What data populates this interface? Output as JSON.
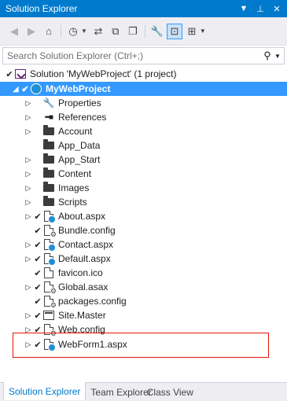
{
  "window": {
    "title": "Solution Explorer",
    "controls": {
      "dropdown": "▼",
      "pin": "⊥",
      "close": "✕"
    }
  },
  "toolbar": {
    "icons": [
      "back-icon",
      "forward-icon",
      "home-icon",
      "pending-changes-icon",
      "sync-icon",
      "collapse-all-icon",
      "show-all-files-icon",
      "properties-icon",
      "preview-icon",
      "class-diagram-icon",
      "dropdown-icon"
    ]
  },
  "search": {
    "placeholder": "Search Solution Explorer (Ctrl+;)"
  },
  "tree": {
    "solution": "Solution 'MyWebProject' (1 project)",
    "project": "MyWebProject",
    "items": [
      {
        "label": "Properties",
        "icon": "wrench-icon",
        "expandable": true,
        "checked": false
      },
      {
        "label": "References",
        "icon": "references-icon",
        "expandable": true,
        "checked": false
      },
      {
        "label": "Account",
        "icon": "folder-icon",
        "expandable": true,
        "checked": false
      },
      {
        "label": "App_Data",
        "icon": "folder-icon",
        "expandable": false,
        "checked": false
      },
      {
        "label": "App_Start",
        "icon": "folder-icon",
        "expandable": true,
        "checked": false
      },
      {
        "label": "Content",
        "icon": "folder-icon",
        "expandable": true,
        "checked": false
      },
      {
        "label": "Images",
        "icon": "folder-icon",
        "expandable": true,
        "checked": false
      },
      {
        "label": "Scripts",
        "icon": "folder-icon",
        "expandable": true,
        "checked": false
      },
      {
        "label": "About.aspx",
        "icon": "aspx-icon",
        "expandable": true,
        "checked": true
      },
      {
        "label": "Bundle.config",
        "icon": "config-icon",
        "expandable": false,
        "checked": true
      },
      {
        "label": "Contact.aspx",
        "icon": "aspx-icon",
        "expandable": true,
        "checked": true
      },
      {
        "label": "Default.aspx",
        "icon": "aspx-icon",
        "expandable": true,
        "checked": true
      },
      {
        "label": "favicon.ico",
        "icon": "image-file-icon",
        "expandable": false,
        "checked": true
      },
      {
        "label": "Global.asax",
        "icon": "asax-icon",
        "expandable": true,
        "checked": true
      },
      {
        "label": "packages.config",
        "icon": "config-icon",
        "expandable": false,
        "checked": true
      },
      {
        "label": "Site.Master",
        "icon": "master-icon",
        "expandable": true,
        "checked": true
      },
      {
        "label": "Web.config",
        "icon": "config-icon",
        "expandable": true,
        "checked": true
      },
      {
        "label": "WebForm1.aspx",
        "icon": "aspx-icon",
        "expandable": true,
        "checked": true
      }
    ]
  },
  "bottom_tabs": {
    "solution_explorer": "Solution Explorer",
    "team_explorer": "Team Explorer",
    "class_view": "Class View"
  },
  "colors": {
    "accent": "#007acc",
    "selection": "#3399ff",
    "highlight_box": "#e51400"
  }
}
